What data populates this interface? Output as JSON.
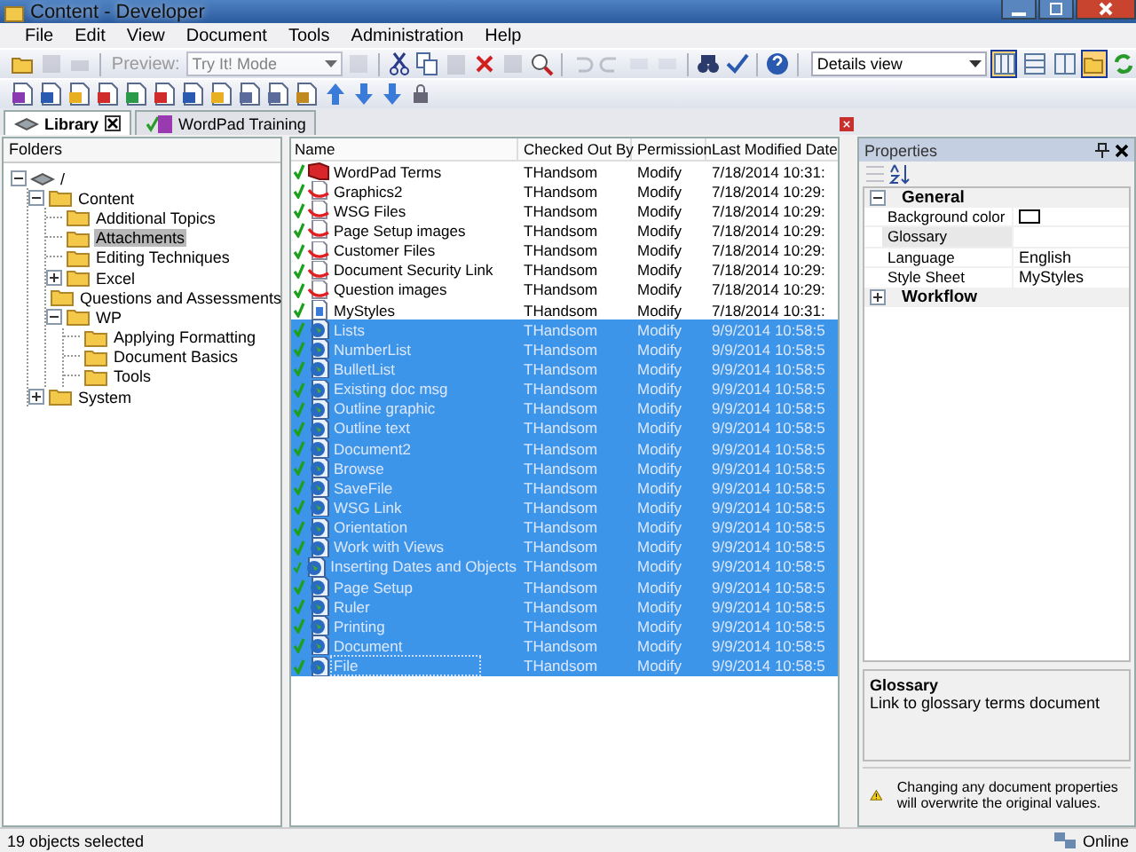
{
  "window": {
    "title": "Content - Developer"
  },
  "menu": [
    "File",
    "Edit",
    "View",
    "Document",
    "Tools",
    "Administration",
    "Help"
  ],
  "toolbar": {
    "preview_label": "Preview:",
    "mode_combo": "Try It! Mode",
    "view_combo": "Details view",
    "view_buttons": [
      {
        "selected": true
      },
      {
        "selected": false
      },
      {
        "selected": false
      }
    ],
    "pane_button": {
      "on": true
    }
  },
  "tabs": [
    {
      "label": "Library",
      "selected": true,
      "closable": true
    },
    {
      "label": "WordPad Training",
      "selected": false,
      "closable": false
    }
  ],
  "folders": {
    "title": "Folders",
    "tree": [
      {
        "label": "/",
        "kind": "root",
        "selected": false,
        "expanded": true,
        "children": [
          {
            "label": "Content",
            "kind": "folder",
            "selected": false,
            "expanded": true,
            "children": [
              {
                "label": "Additional Topics",
                "kind": "folder",
                "selected": false
              },
              {
                "label": "Attachments",
                "kind": "folder",
                "selected": true
              },
              {
                "label": "Editing Techniques",
                "kind": "folder",
                "selected": false
              },
              {
                "label": "Excel",
                "kind": "folder",
                "selected": false,
                "expanded": false
              },
              {
                "label": "Questions and Assessments",
                "kind": "folder",
                "selected": false
              },
              {
                "label": "WP",
                "kind": "folder",
                "selected": false,
                "expanded": true,
                "children": [
                  {
                    "label": "Applying Formatting",
                    "kind": "folder",
                    "selected": false
                  },
                  {
                    "label": "Document Basics",
                    "kind": "folder",
                    "selected": false
                  },
                  {
                    "label": "Tools",
                    "kind": "folder",
                    "selected": false
                  }
                ]
              }
            ]
          },
          {
            "label": "System",
            "kind": "folder",
            "selected": false,
            "expanded": false
          }
        ]
      }
    ]
  },
  "list": {
    "columns": [
      "Name",
      "Checked Out By",
      "Permission",
      "Last Modified Date"
    ],
    "rows": [
      {
        "name": "WordPad Terms",
        "kind": "book",
        "checked_out": true,
        "by": "THandsom",
        "permission": "Modify",
        "modified": "7/18/2014 10:31:",
        "selected": false,
        "focused": false
      },
      {
        "name": "Graphics2",
        "kind": "link",
        "checked_out": true,
        "by": "THandsom",
        "permission": "Modify",
        "modified": "7/18/2014 10:29:",
        "selected": false,
        "focused": false
      },
      {
        "name": "WSG Files",
        "kind": "link",
        "checked_out": true,
        "by": "THandsom",
        "permission": "Modify",
        "modified": "7/18/2014 10:29:",
        "selected": false,
        "focused": false
      },
      {
        "name": "Page Setup images",
        "kind": "link",
        "checked_out": true,
        "by": "THandsom",
        "permission": "Modify",
        "modified": "7/18/2014 10:29:",
        "selected": false,
        "focused": false
      },
      {
        "name": "Customer Files",
        "kind": "link",
        "checked_out": true,
        "by": "THandsom",
        "permission": "Modify",
        "modified": "7/18/2014 10:29:",
        "selected": false,
        "focused": false
      },
      {
        "name": "Document Security Link",
        "kind": "link",
        "checked_out": true,
        "by": "THandsom",
        "permission": "Modify",
        "modified": "7/18/2014 10:29:",
        "selected": false,
        "focused": false
      },
      {
        "name": "Question images",
        "kind": "link",
        "checked_out": true,
        "by": "THandsom",
        "permission": "Modify",
        "modified": "7/18/2014 10:29:",
        "selected": false,
        "focused": false
      },
      {
        "name": "MyStyles",
        "kind": "stylesheet",
        "checked_out": true,
        "by": "THandsom",
        "permission": "Modify",
        "modified": "7/18/2014 10:31:",
        "selected": false,
        "focused": false
      },
      {
        "name": "Lists",
        "kind": "web",
        "checked_out": true,
        "by": "THandsom",
        "permission": "Modify",
        "modified": "9/9/2014 10:58:5",
        "selected": true,
        "focused": false
      },
      {
        "name": "NumberList",
        "kind": "web",
        "checked_out": true,
        "by": "THandsom",
        "permission": "Modify",
        "modified": "9/9/2014 10:58:5",
        "selected": true,
        "focused": false
      },
      {
        "name": "BulletList",
        "kind": "web",
        "checked_out": true,
        "by": "THandsom",
        "permission": "Modify",
        "modified": "9/9/2014 10:58:5",
        "selected": true,
        "focused": false
      },
      {
        "name": "Existing doc msg",
        "kind": "web",
        "checked_out": true,
        "by": "THandsom",
        "permission": "Modify",
        "modified": "9/9/2014 10:58:5",
        "selected": true,
        "focused": false
      },
      {
        "name": "Outline graphic",
        "kind": "web",
        "checked_out": true,
        "by": "THandsom",
        "permission": "Modify",
        "modified": "9/9/2014 10:58:5",
        "selected": true,
        "focused": false
      },
      {
        "name": "Outline text",
        "kind": "web",
        "checked_out": true,
        "by": "THandsom",
        "permission": "Modify",
        "modified": "9/9/2014 10:58:5",
        "selected": true,
        "focused": false
      },
      {
        "name": "Document2",
        "kind": "web",
        "checked_out": true,
        "by": "THandsom",
        "permission": "Modify",
        "modified": "9/9/2014 10:58:5",
        "selected": true,
        "focused": false
      },
      {
        "name": "Browse",
        "kind": "web",
        "checked_out": true,
        "by": "THandsom",
        "permission": "Modify",
        "modified": "9/9/2014 10:58:5",
        "selected": true,
        "focused": false
      },
      {
        "name": "SaveFile",
        "kind": "web",
        "checked_out": true,
        "by": "THandsom",
        "permission": "Modify",
        "modified": "9/9/2014 10:58:5",
        "selected": true,
        "focused": false
      },
      {
        "name": "WSG Link",
        "kind": "web",
        "checked_out": true,
        "by": "THandsom",
        "permission": "Modify",
        "modified": "9/9/2014 10:58:5",
        "selected": true,
        "focused": false
      },
      {
        "name": "Orientation",
        "kind": "web",
        "checked_out": true,
        "by": "THandsom",
        "permission": "Modify",
        "modified": "9/9/2014 10:58:5",
        "selected": true,
        "focused": false
      },
      {
        "name": "Work with Views",
        "kind": "web",
        "checked_out": true,
        "by": "THandsom",
        "permission": "Modify",
        "modified": "9/9/2014 10:58:5",
        "selected": true,
        "focused": false
      },
      {
        "name": "Inserting Dates and Objects",
        "kind": "web",
        "checked_out": true,
        "by": "THandsom",
        "permission": "Modify",
        "modified": "9/9/2014 10:58:5",
        "selected": true,
        "focused": false
      },
      {
        "name": "Page Setup",
        "kind": "web",
        "checked_out": true,
        "by": "THandsom",
        "permission": "Modify",
        "modified": "9/9/2014 10:58:5",
        "selected": true,
        "focused": false
      },
      {
        "name": "Ruler",
        "kind": "web",
        "checked_out": true,
        "by": "THandsom",
        "permission": "Modify",
        "modified": "9/9/2014 10:58:5",
        "selected": true,
        "focused": false
      },
      {
        "name": "Printing",
        "kind": "web",
        "checked_out": true,
        "by": "THandsom",
        "permission": "Modify",
        "modified": "9/9/2014 10:58:5",
        "selected": true,
        "focused": false
      },
      {
        "name": "Document",
        "kind": "web",
        "checked_out": true,
        "by": "THandsom",
        "permission": "Modify",
        "modified": "9/9/2014 10:58:5",
        "selected": true,
        "focused": false
      },
      {
        "name": "File",
        "kind": "web",
        "checked_out": true,
        "by": "THandsom",
        "permission": "Modify",
        "modified": "9/9/2014 10:58:5",
        "selected": true,
        "focused": true
      }
    ]
  },
  "properties": {
    "title": "Properties",
    "groups": [
      {
        "label": "General",
        "expanded": true,
        "rows": [
          {
            "name": "Background color",
            "kind": "swatch",
            "color": "#ffffff",
            "selected": false
          },
          {
            "name": "Glossary",
            "kind": "text",
            "selected": true
          },
          {
            "name": "Language",
            "kind": "text",
            "value": "English",
            "selected": false
          },
          {
            "name": "Style Sheet",
            "kind": "text",
            "value": "MyStyles",
            "selected": false
          }
        ]
      },
      {
        "label": "Workflow",
        "expanded": false
      }
    ],
    "description": {
      "title": "Glossary",
      "text": "Link to glossary terms document"
    },
    "warning": "Changing any document properties will overwrite the original values."
  },
  "status_bar": {
    "left": "19 objects selected",
    "right": "Online"
  }
}
